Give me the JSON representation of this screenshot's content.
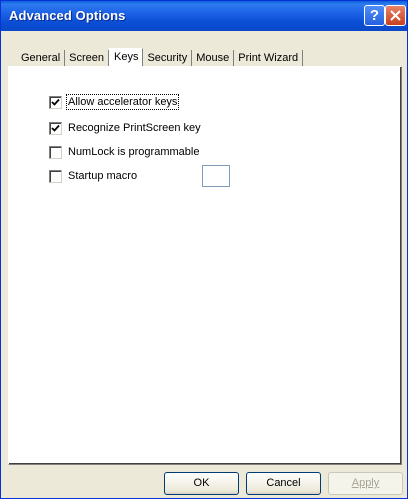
{
  "window": {
    "title": "Advanced Options",
    "help_button": "?"
  },
  "tabs": [
    {
      "label": "General"
    },
    {
      "label": "Screen"
    },
    {
      "label": "Keys",
      "active": true
    },
    {
      "label": "Security"
    },
    {
      "label": "Mouse"
    },
    {
      "label": "Print Wizard"
    }
  ],
  "options": [
    {
      "label": "Allow accelerator keys",
      "checked": true
    },
    {
      "label": "Recognize PrintScreen key",
      "checked": true
    },
    {
      "label": "NumLock is programmable",
      "checked": false
    },
    {
      "label": "Startup macro",
      "checked": false
    }
  ],
  "startup_macro_value": "",
  "buttons": {
    "ok": "OK",
    "cancel": "Cancel",
    "apply": "Apply"
  },
  "colors": {
    "titlebar": "#0a5fd8",
    "dialog_bg": "#ece9d8",
    "close_button": "#c5401f"
  }
}
